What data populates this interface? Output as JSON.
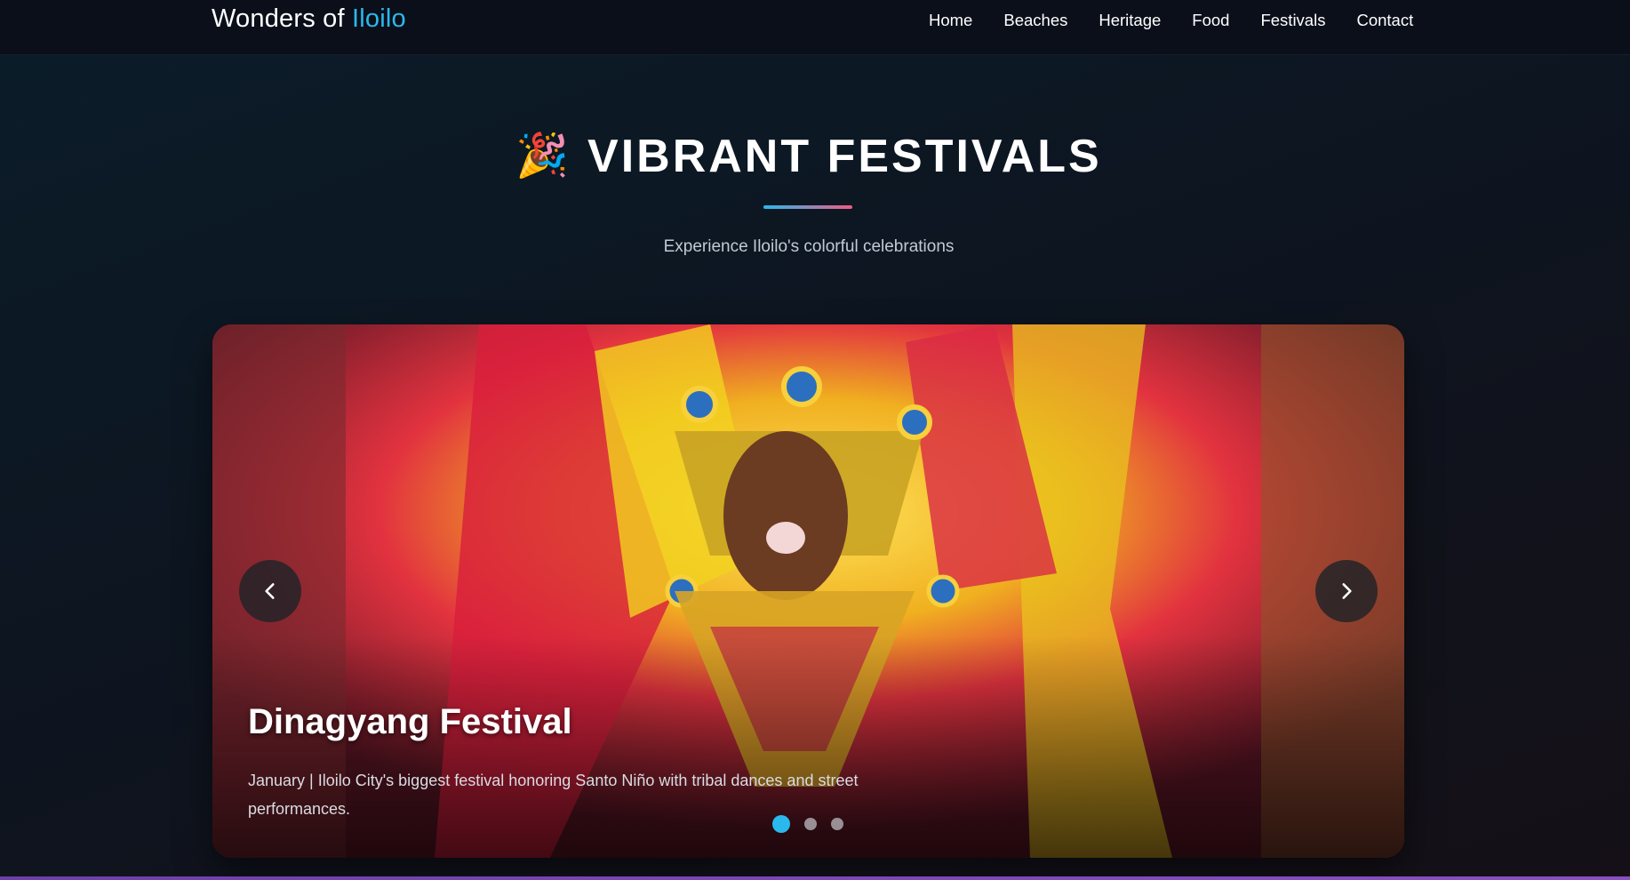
{
  "header": {
    "brand_prefix": "Wonders of",
    "brand_accent": "Iloilo",
    "nav": [
      "Home",
      "Beaches",
      "Heritage",
      "Food",
      "Festivals",
      "Contact"
    ]
  },
  "section": {
    "emoji": "🎉",
    "title": "VIBRANT FESTIVALS",
    "subtitle": "Experience Iloilo's colorful celebrations"
  },
  "carousel": {
    "slide_title": "Dinagyang Festival",
    "slide_description": "January | Iloilo City's biggest festival honoring Santo Niño with tribal dances and street performances.",
    "active_index": 0,
    "slide_count": 3
  },
  "colors": {
    "accent": "#2bb8ec",
    "underline_end": "#f05a84",
    "background": "#0d1520"
  },
  "icons": {
    "prev": "chevron-left-icon",
    "next": "chevron-right-icon"
  }
}
